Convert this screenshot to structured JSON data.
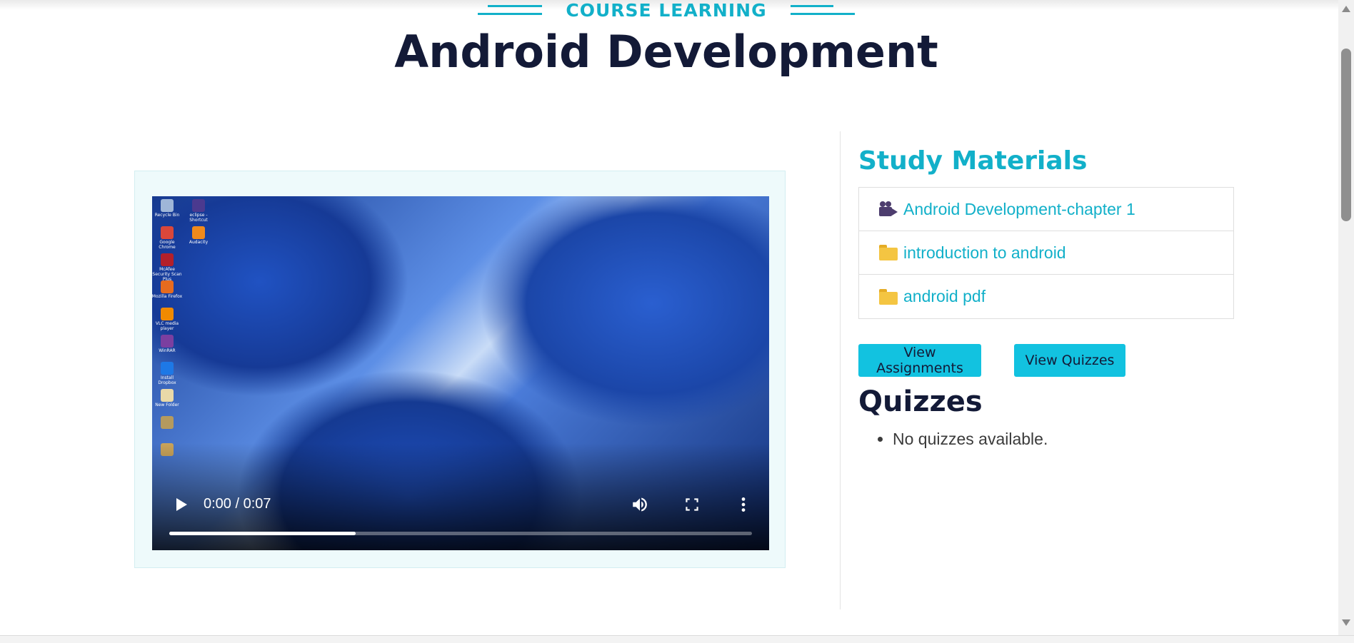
{
  "header": {
    "eyebrow": "COURSE LEARNING",
    "title": "Android Development"
  },
  "video": {
    "time": "0:00 / 0:07",
    "progress_fraction": 0.32,
    "desktop_icons": [
      {
        "label": "Recycle Bin",
        "icon": "recycle-bin-icon",
        "color": "#9fb6d8"
      },
      {
        "label": "eclipse - Shortcut",
        "icon": "eclipse-icon",
        "color": "#4b3a8f"
      },
      {
        "label": "Google Chrome",
        "icon": "chrome-icon",
        "color": "#d9473a"
      },
      {
        "label": "Audacity",
        "icon": "audacity-icon",
        "color": "#f08a1c"
      },
      {
        "label": "McAfee Security Scan Plus",
        "icon": "mcafee-icon",
        "color": "#b3202a"
      },
      {
        "label": "Mozilla Firefox",
        "icon": "firefox-icon",
        "color": "#e66b1f"
      },
      {
        "label": "VLC media player",
        "icon": "vlc-icon",
        "color": "#f08a00"
      },
      {
        "label": "WinRAR",
        "icon": "winrar-icon",
        "color": "#7b3fa0"
      },
      {
        "label": "Install Dropbox",
        "icon": "dropbox-icon",
        "color": "#1d78e6"
      },
      {
        "label": "New Folder",
        "icon": "folder-icon",
        "color": "#e9d9a8"
      },
      {
        "label": "",
        "icon": "archive-icon",
        "color": "#b59a5e"
      },
      {
        "label": "",
        "icon": "archive-icon",
        "color": "#c9a35a"
      }
    ]
  },
  "sidebar": {
    "study_title": "Study Materials",
    "materials": [
      {
        "label": "Android Development-chapter 1",
        "icon": "video-camera-icon"
      },
      {
        "label": "introduction to android",
        "icon": "folder-icon"
      },
      {
        "label": "android pdf",
        "icon": "folder-icon"
      }
    ],
    "buttons": {
      "assignments": "View Assignments",
      "quizzes": "View Quizzes"
    },
    "quizzes_title": "Quizzes",
    "quiz_items": [
      "No quizzes available."
    ]
  },
  "colors": {
    "accent": "#12b0c9",
    "button": "#12c2e0",
    "heading": "#131a37"
  }
}
